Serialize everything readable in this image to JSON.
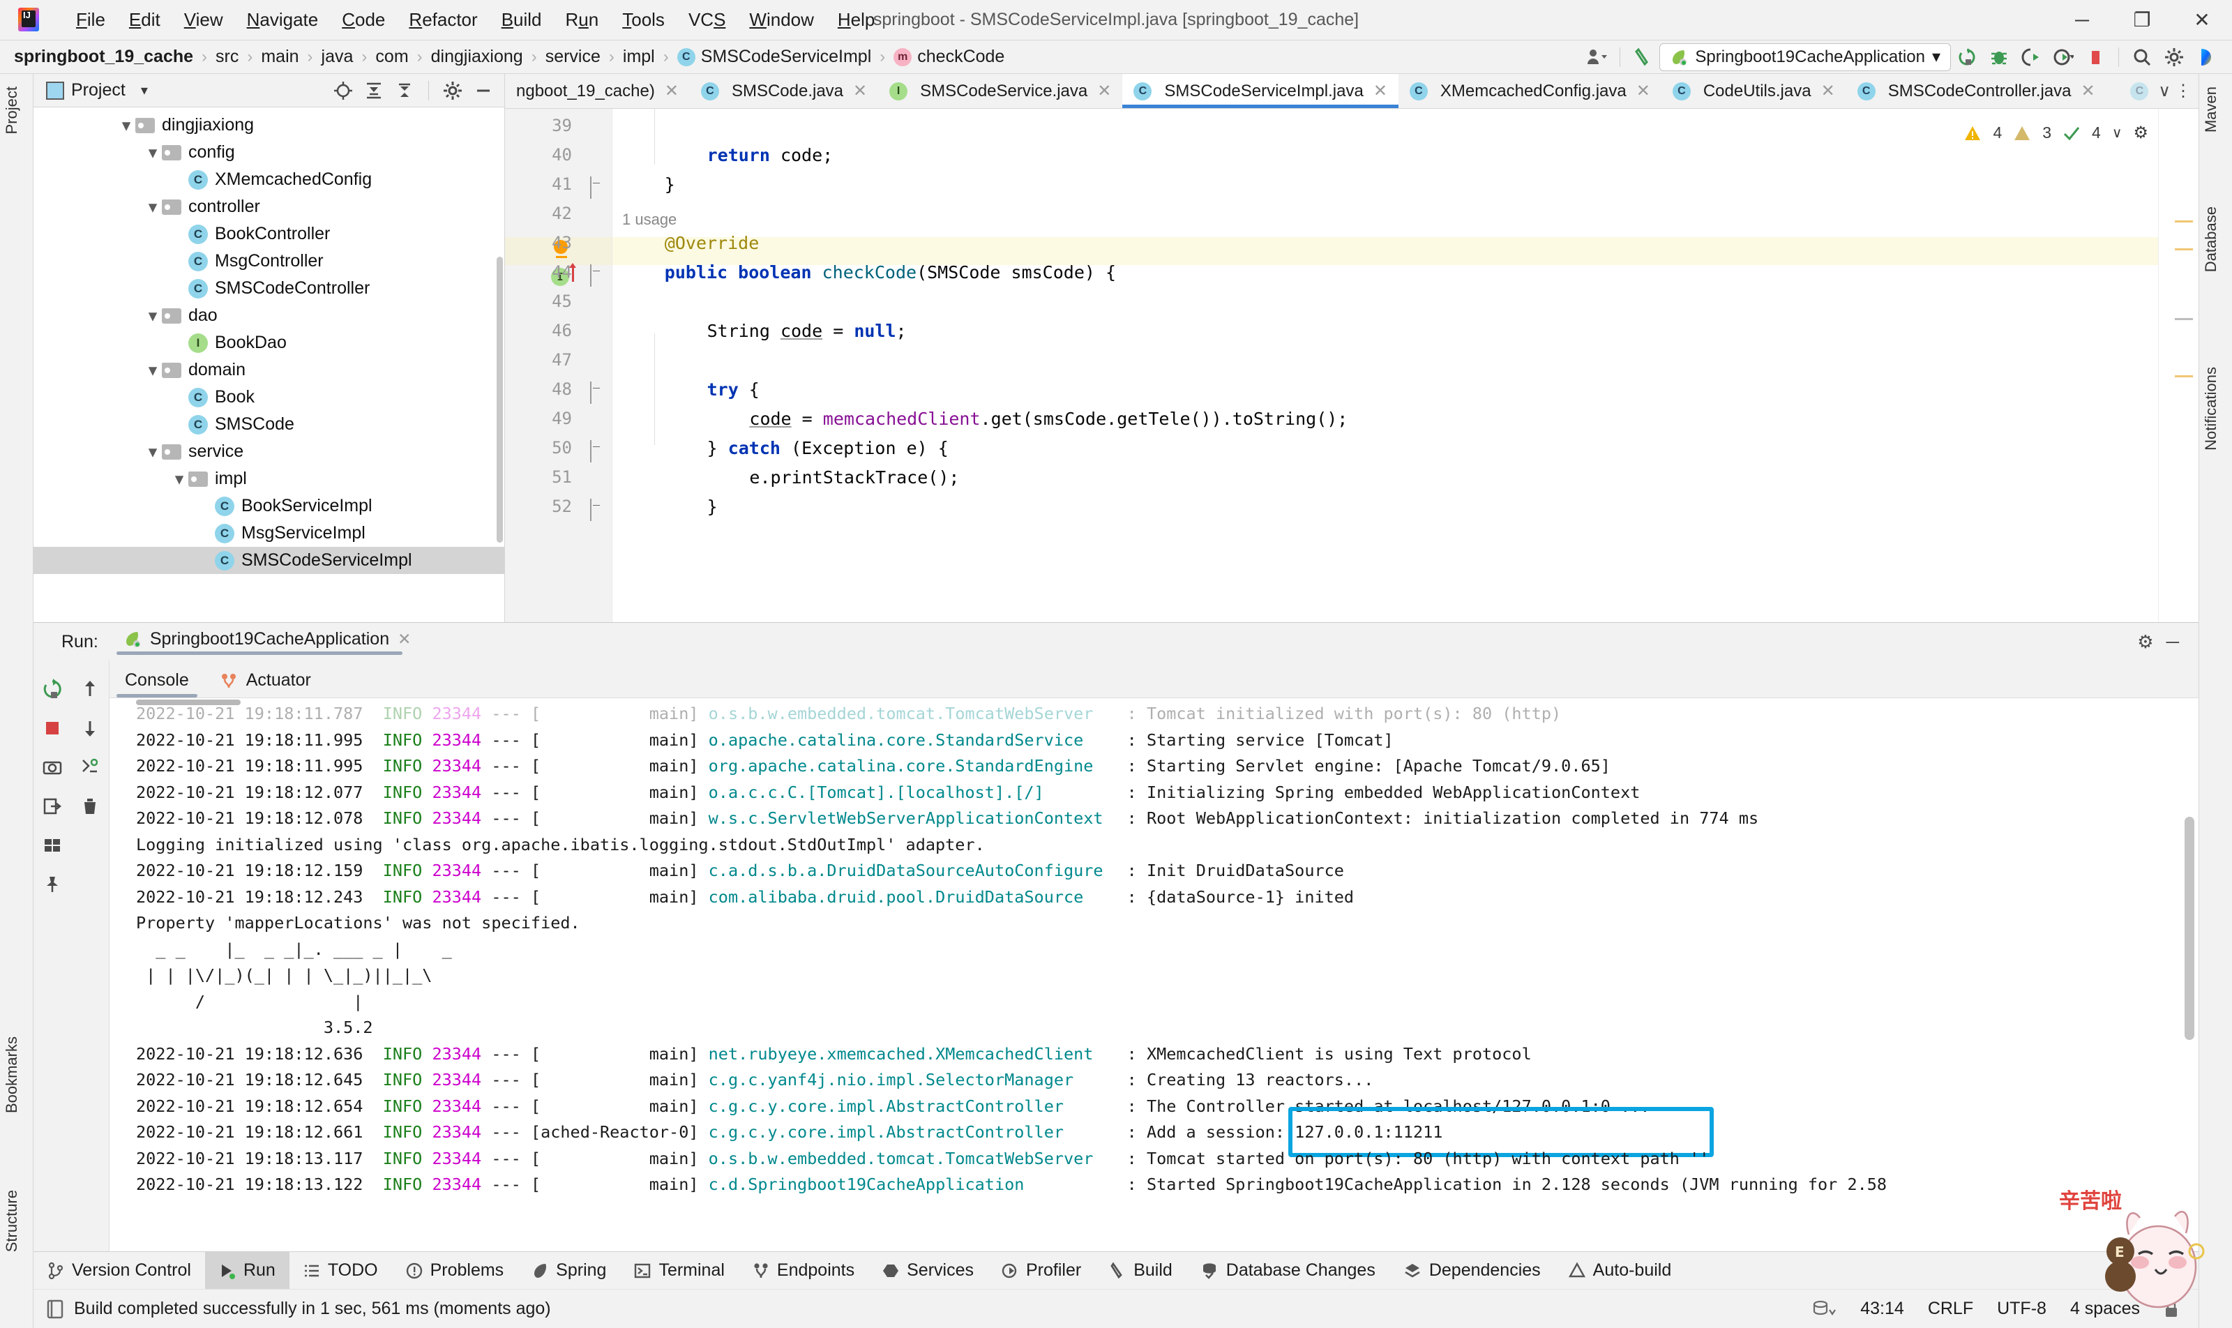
{
  "window": {
    "title": "springboot - SMSCodeServiceImpl.java [springboot_19_cache]",
    "minimize": "─",
    "maximize": "❐",
    "close": "✕"
  },
  "menu": {
    "items": [
      "File",
      "Edit",
      "View",
      "Navigate",
      "Code",
      "Refactor",
      "Build",
      "Run",
      "Tools",
      "VCS",
      "Window",
      "Help"
    ]
  },
  "breadcrumb": {
    "items": [
      {
        "label": "springboot_19_cache",
        "icon": "",
        "bold": true
      },
      {
        "label": "src",
        "icon": ""
      },
      {
        "label": "main",
        "icon": ""
      },
      {
        "label": "java",
        "icon": ""
      },
      {
        "label": "com",
        "icon": ""
      },
      {
        "label": "dingjiaxiong",
        "icon": ""
      },
      {
        "label": "service",
        "icon": ""
      },
      {
        "label": "impl",
        "icon": ""
      },
      {
        "label": "SMSCodeServiceImpl",
        "icon": "c"
      },
      {
        "label": "checkCode",
        "icon": "m"
      }
    ],
    "separator": "›"
  },
  "toolbar": {
    "run_config": "Springboot19CacheApplication",
    "run_config_caret": "▾",
    "icons": [
      "user-icon",
      "build-hammer-icon",
      "rerun-icon",
      "debug-icon",
      "coverage-icon",
      "profile-icon",
      "stop-icon",
      "search-icon",
      "settings-icon",
      "idea-icon"
    ]
  },
  "project_panel": {
    "title": "Project",
    "dropdown_caret": "▾",
    "tools": [
      "locate-icon",
      "expand-all-icon",
      "collapse-all-icon",
      "gear-icon",
      "hide-icon"
    ],
    "tree": [
      {
        "label": "dingjiaxiong",
        "type": "folder",
        "indent": 0,
        "expanded": true
      },
      {
        "label": "config",
        "type": "folder",
        "indent": 1,
        "expanded": true
      },
      {
        "label": "XMemcachedConfig",
        "type": "class",
        "indent": 2
      },
      {
        "label": "controller",
        "type": "folder",
        "indent": 1,
        "expanded": true
      },
      {
        "label": "BookController",
        "type": "class",
        "indent": 2
      },
      {
        "label": "MsgController",
        "type": "class",
        "indent": 2
      },
      {
        "label": "SMSCodeController",
        "type": "class",
        "indent": 2
      },
      {
        "label": "dao",
        "type": "folder",
        "indent": 1,
        "expanded": true
      },
      {
        "label": "BookDao",
        "type": "interface",
        "indent": 2
      },
      {
        "label": "domain",
        "type": "folder",
        "indent": 1,
        "expanded": true
      },
      {
        "label": "Book",
        "type": "class",
        "indent": 2
      },
      {
        "label": "SMSCode",
        "type": "class",
        "indent": 2
      },
      {
        "label": "service",
        "type": "folder",
        "indent": 1,
        "expanded": true
      },
      {
        "label": "impl",
        "type": "folder",
        "indent": 2,
        "expanded": true
      },
      {
        "label": "BookServiceImpl",
        "type": "class",
        "indent": 3
      },
      {
        "label": "MsgServiceImpl",
        "type": "class",
        "indent": 3
      },
      {
        "label": "SMSCodeServiceImpl",
        "type": "class",
        "indent": 3,
        "selected": true
      }
    ]
  },
  "editor": {
    "tabs": [
      {
        "label": "ngboot_19_cache)",
        "icon": "",
        "active": false,
        "truncated": true
      },
      {
        "label": "SMSCode.java",
        "icon": "c",
        "active": false
      },
      {
        "label": "SMSCodeService.java",
        "icon": "i",
        "active": false
      },
      {
        "label": "SMSCodeServiceImpl.java",
        "icon": "c",
        "active": true
      },
      {
        "label": "XMemcachedConfig.java",
        "icon": "c",
        "active": false
      },
      {
        "label": "CodeUtils.java",
        "icon": "c",
        "active": false
      },
      {
        "label": "SMSCodeController.java",
        "icon": "c",
        "active": false
      }
    ],
    "tabs_overflow_caret": "∨",
    "tabs_more": "⋮",
    "inspection": {
      "warnings": "4",
      "weak_warnings": "3",
      "checks": "4",
      "warning_icon": "⚠",
      "weak_icon": "⚠",
      "ok_icon": "✔",
      "caret": "∨",
      "gear": "⚙"
    },
    "usage_hint": "1 usage",
    "lines": [
      {
        "num": "39",
        "text": ""
      },
      {
        "num": "40",
        "indent": 2,
        "segments": [
          {
            "t": "return",
            "c": "kw"
          },
          {
            "t": " code;",
            "c": ""
          }
        ]
      },
      {
        "num": "41",
        "indent": 1,
        "segments": [
          {
            "t": "}",
            "c": ""
          }
        ]
      },
      {
        "num": "42",
        "text": ""
      },
      {
        "num": "43",
        "indent": 1,
        "highlight": true,
        "segments": [
          {
            "t": "@Override",
            "c": "anno"
          }
        ]
      },
      {
        "num": "44",
        "indent": 1,
        "segments": [
          {
            "t": "public",
            "c": "kw"
          },
          {
            "t": " ",
            "c": ""
          },
          {
            "t": "boolean",
            "c": "kw"
          },
          {
            "t": " ",
            "c": ""
          },
          {
            "t": "checkCode",
            "c": "mth"
          },
          {
            "t": "(SMSCode smsCode) {",
            "c": ""
          }
        ]
      },
      {
        "num": "45",
        "text": ""
      },
      {
        "num": "46",
        "indent": 2,
        "segments": [
          {
            "t": "String ",
            "c": ""
          },
          {
            "t": "code",
            "c": "und"
          },
          {
            "t": " = ",
            "c": ""
          },
          {
            "t": "null",
            "c": "kw"
          },
          {
            "t": ";",
            "c": ""
          }
        ]
      },
      {
        "num": "47",
        "text": ""
      },
      {
        "num": "48",
        "indent": 2,
        "segments": [
          {
            "t": "try",
            "c": "kw"
          },
          {
            "t": " {",
            "c": ""
          }
        ]
      },
      {
        "num": "49",
        "indent": 3,
        "segments": [
          {
            "t": "code",
            "c": "und"
          },
          {
            "t": " = ",
            "c": ""
          },
          {
            "t": "memcachedClient",
            "c": "fld"
          },
          {
            "t": ".get(smsCode.getTele()).toString();",
            "c": ""
          }
        ]
      },
      {
        "num": "50",
        "indent": 2,
        "segments": [
          {
            "t": "} ",
            "c": ""
          },
          {
            "t": "catch",
            "c": "kw"
          },
          {
            "t": " (Exception e) {",
            "c": ""
          }
        ]
      },
      {
        "num": "51",
        "indent": 3,
        "segments": [
          {
            "t": "e.printStackTrace();",
            "c": ""
          }
        ]
      },
      {
        "num": "52",
        "indent": 2,
        "segments": [
          {
            "t": "}",
            "c": ""
          }
        ]
      }
    ]
  },
  "run_window": {
    "label": "Run:",
    "config_name": "Springboot19CacheApplication",
    "close_x": "✕",
    "settings_icon": "⚙",
    "hide_icon": "─",
    "console_tabs": [
      {
        "label": "Console",
        "icon": "console-icon",
        "active": true
      },
      {
        "label": "Actuator",
        "icon": "actuator-icon",
        "active": false
      }
    ],
    "sidebar_icons": [
      "rerun-icon",
      "scroll-up-icon",
      "stop-icon",
      "scroll-down-icon",
      "camera-icon",
      "thread-dump-icon",
      "export-icon",
      "print-icon",
      "trash-icon",
      "layout-icon",
      "pin-icon"
    ],
    "console_lines": [
      {
        "y": 0,
        "clipped": true,
        "ts": "2022-10-21 19:18:11.787",
        "level": "INFO",
        "pid": "23344",
        "sep": "--- [",
        "thread": "           main]",
        "cls": "o.s.b.w.embedded.tomcat.TomcatWebServer",
        "msg": ": Tomcat initialized with port(s): 80 (http)"
      },
      {
        "ts": "2022-10-21 19:18:11.995",
        "level": "INFO",
        "pid": "23344",
        "sep": "--- [",
        "thread": "           main]",
        "cls": "o.apache.catalina.core.StandardService",
        "msg": ": Starting service [Tomcat]"
      },
      {
        "ts": "2022-10-21 19:18:11.995",
        "level": "INFO",
        "pid": "23344",
        "sep": "--- [",
        "thread": "           main]",
        "cls": "org.apache.catalina.core.StandardEngine",
        "msg": ": Starting Servlet engine: [Apache Tomcat/9.0.65]"
      },
      {
        "ts": "2022-10-21 19:18:12.077",
        "level": "INFO",
        "pid": "23344",
        "sep": "--- [",
        "thread": "           main]",
        "cls": "o.a.c.c.C.[Tomcat].[localhost].[/]",
        "msg": ": Initializing Spring embedded WebApplicationContext"
      },
      {
        "ts": "2022-10-21 19:18:12.078",
        "level": "INFO",
        "pid": "23344",
        "sep": "--- [",
        "thread": "           main]",
        "cls": "w.s.c.ServletWebServerApplicationContext",
        "msg": ": Root WebApplicationContext: initialization completed in 774 ms"
      },
      {
        "plain": "Logging initialized using 'class org.apache.ibatis.logging.stdout.StdOutImpl' adapter."
      },
      {
        "ts": "2022-10-21 19:18:12.159",
        "level": "INFO",
        "pid": "23344",
        "sep": "--- [",
        "thread": "           main]",
        "cls": "c.a.d.s.b.a.DruidDataSourceAutoConfigure",
        "msg": ": Init DruidDataSource"
      },
      {
        "ts": "2022-10-21 19:18:12.243",
        "level": "INFO",
        "pid": "23344",
        "sep": "--- [",
        "thread": "           main]",
        "cls": "com.alibaba.druid.pool.DruidDataSource",
        "msg": ": {dataSource-1} inited"
      },
      {
        "plain": "Property 'mapperLocations' was not specified."
      },
      {
        "banner": "  _ _    |_  _ _|_. ___ _ |    _"
      },
      {
        "banner": " | | |\\/|_)(_| | | \\_|_)||_|_\\"
      },
      {
        "banner": "      /               |"
      },
      {
        "banner": "                   3.5.2"
      },
      {
        "ts": "2022-10-21 19:18:12.636",
        "level": "INFO",
        "pid": "23344",
        "sep": "--- [",
        "thread": "           main]",
        "cls": "net.rubyeye.xmemcached.XMemcachedClient",
        "msg": ": XMemcachedClient is using Text protocol"
      },
      {
        "ts": "2022-10-21 19:18:12.645",
        "level": "INFO",
        "pid": "23344",
        "sep": "--- [",
        "thread": "           main]",
        "cls": "c.g.c.yanf4j.nio.impl.SelectorManager",
        "msg": ": Creating 13 reactors..."
      },
      {
        "ts": "2022-10-21 19:18:12.654",
        "level": "INFO",
        "pid": "23344",
        "sep": "--- [",
        "thread": "           main]",
        "cls": "c.g.c.y.core.impl.AbstractController",
        "msg": ": The Controller started at localhost/127.0.0.1:0 ..."
      },
      {
        "ts": "2022-10-21 19:18:12.661",
        "level": "INFO",
        "pid": "23344",
        "sep": "--- [",
        "thread": "ached-Reactor-0]",
        "cls": "c.g.c.y.core.impl.AbstractController",
        "msg": ": Add a session: 127.0.0.1:11211",
        "highlighted": true
      },
      {
        "ts": "2022-10-21 19:18:13.117",
        "level": "INFO",
        "pid": "23344",
        "sep": "--- [",
        "thread": "           main]",
        "cls": "o.s.b.w.embedded.tomcat.TomcatWebServer",
        "msg": ": Tomcat started on port(s): 80 (http) with context path ''"
      },
      {
        "ts": "2022-10-21 19:18:13.122",
        "level": "INFO",
        "pid": "23344",
        "sep": "--- [",
        "thread": "           main]",
        "cls": "c.d.Springboot19CacheApplication",
        "msg": ": Started Springboot19CacheApplication in 2.128 seconds (JVM running for 2.58"
      }
    ],
    "highlight_color": "#0aa5e0"
  },
  "tool_strip": {
    "items": [
      {
        "label": "Version Control",
        "icon": "branch-icon"
      },
      {
        "label": "Run",
        "icon": "run-icon",
        "active": true
      },
      {
        "label": "TODO",
        "icon": "todo-icon"
      },
      {
        "label": "Problems",
        "icon": "problems-icon"
      },
      {
        "label": "Spring",
        "icon": "spring-icon"
      },
      {
        "label": "Terminal",
        "icon": "terminal-icon"
      },
      {
        "label": "Endpoints",
        "icon": "endpoints-icon"
      },
      {
        "label": "Services",
        "icon": "services-icon"
      },
      {
        "label": "Profiler",
        "icon": "profiler-icon"
      },
      {
        "label": "Build",
        "icon": "build-icon"
      },
      {
        "label": "Database Changes",
        "icon": "database-changes-icon"
      },
      {
        "label": "Dependencies",
        "icon": "dependencies-icon"
      },
      {
        "label": "Auto-build",
        "icon": "auto-build-icon"
      }
    ]
  },
  "status_bar": {
    "message": "Build completed successfully in 1 sec, 561 ms (moments ago)",
    "caret_position": "43:14",
    "line_separator": "CRLF",
    "encoding": "UTF-8",
    "indent": "4 spaces",
    "lock_icon": "🔒"
  },
  "side_tabs": {
    "left": [
      "Project",
      "Bookmarks",
      "Structure"
    ],
    "right": [
      "Maven",
      "Database",
      "Notifications"
    ]
  }
}
